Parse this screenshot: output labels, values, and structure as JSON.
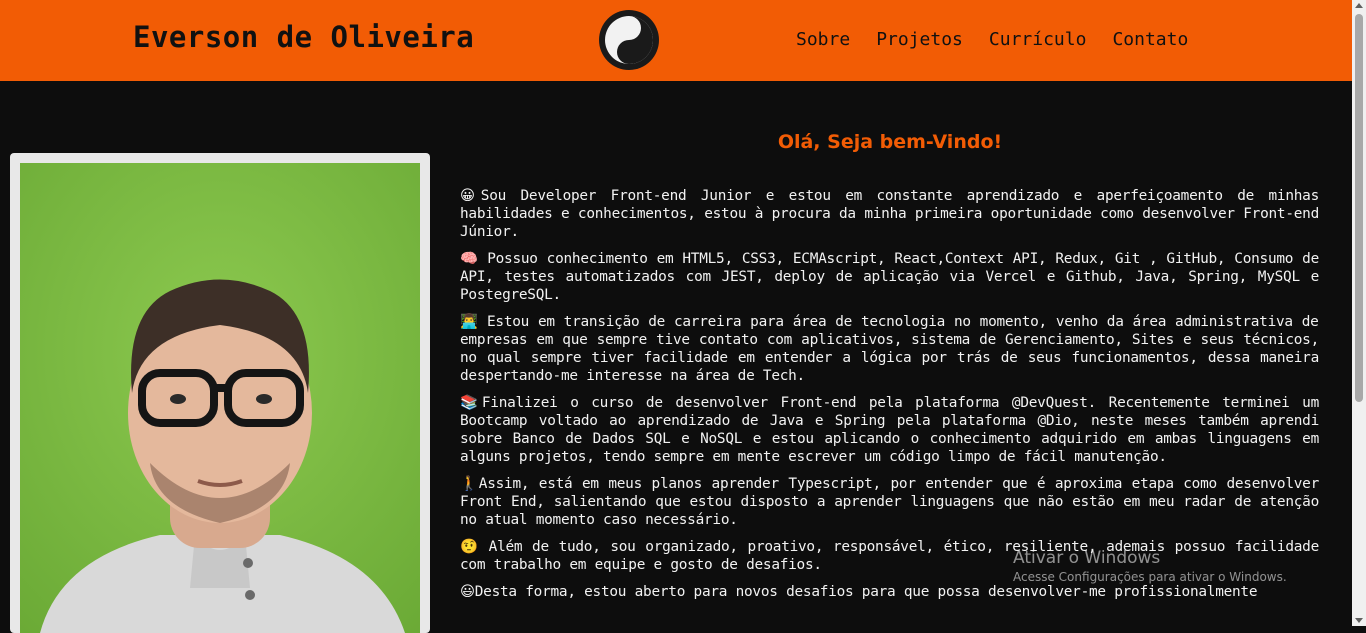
{
  "header": {
    "brand": "Everson de Oliveira",
    "logo_icon": "yin-yang-icon",
    "nav": [
      "Sobre",
      "Projetos",
      "Currículo",
      "Contato"
    ],
    "colors": {
      "background": "#f25c05",
      "text": "#111111"
    }
  },
  "main": {
    "greeting": "Olá, Seja bem-Vindo!",
    "paragraphs": [
      {
        "emoji": "😀",
        "text": "Sou Developer Front-end Junior e estou em constante aprendizado e aperfeiçoamento de minhas habilidades e conhecimentos, estou à procura da minha primeira oportunidade como desenvolver Front-end Júnior."
      },
      {
        "emoji": "🧠",
        "text": " Possuo conhecimento em HTML5, CSS3, ECMAscript, React,Context API, Redux, Git , GitHub, Consumo de API, testes automatizados com JEST, deploy de aplicação via Vercel e Github, Java, Spring, MySQL e PostegreSQL."
      },
      {
        "emoji": "👨‍💻",
        "text": " Estou em transição de carreira para área de tecnologia no momento, venho da área administrativa de empresas em que sempre tive contato com aplicativos, sistema de Gerenciamento, Sites e seus técnicos, no qual sempre tiver facilidade em entender a lógica por trás de seus funcionamentos, dessa maneira despertando-me interesse na área de Tech."
      },
      {
        "emoji": "📚",
        "text": "Finalizei o curso de desenvolver Front-end pela plataforma @DevQuest. Recentemente terminei um Bootcamp voltado ao aprendizado de Java e Spring pela plataforma @Dio, neste meses também aprendi sobre Banco de Dados SQL e NoSQL e estou aplicando o conhecimento adquirido em ambas linguagens em alguns projetos, tendo sempre em mente escrever um código limpo de fácil manutenção."
      },
      {
        "emoji": "🚶",
        "text": "Assim, está em meus planos aprender Typescript, por entender que é aproxima etapa como desenvolver Front End, salientando que estou disposto a aprender linguagens que não estão em meu radar de atenção no atual momento caso necessário."
      },
      {
        "emoji": "🤨",
        "text": " Além de tudo, sou organizado, proativo, responsável, ético, resiliente, ademais possuo facilidade com trabalho em equipe e gosto de desafios."
      },
      {
        "emoji": "😃",
        "text": "Desta forma, estou aberto para novos desafios para que possa desenvolver-me profissionalmente"
      }
    ],
    "accent_color": "#f25c05"
  },
  "watermark": {
    "title": "Ativar o Windows",
    "subtitle": "Acesse Configurações para ativar o Windows."
  }
}
